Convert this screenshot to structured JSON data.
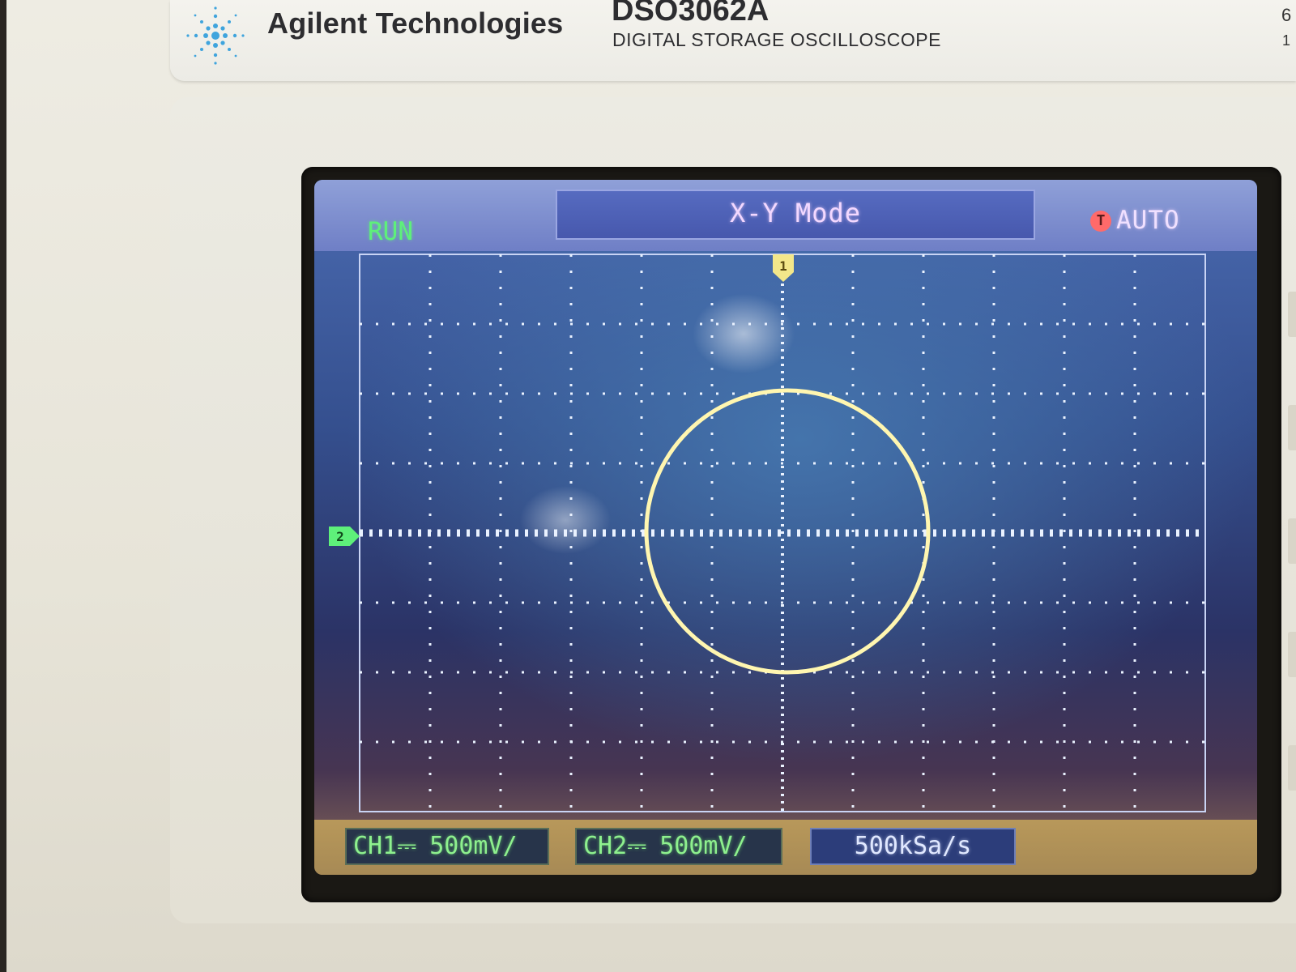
{
  "header": {
    "brand": "Agilent Technologies",
    "model": "DSO3062A",
    "model_subtitle": "DIGITAL STORAGE OSCILLOSCOPE",
    "edge_digit_top": "6",
    "edge_digit_bottom": "1"
  },
  "screen": {
    "run_status": "RUN",
    "mode_title": "X-Y Mode",
    "trigger_icon": "T",
    "trigger_mode": "AUTO",
    "ch1_scale": "500mV/",
    "ch2_scale": "500mV/",
    "ch1_label": "CH1",
    "ch2_label": "CH2",
    "sample_rate": "500kSa/s",
    "marker_1": "1",
    "marker_2": "2"
  },
  "colors": {
    "run_green": "#5ef07a",
    "trace_yellow": "#fff6b0",
    "grid_white": "#eaf2ff",
    "trigger_red": "#ff6a6a"
  },
  "icons": [
    "agilent-spark-logo-icon",
    "trigger-t-icon",
    "channel-marker-1-icon",
    "channel-marker-2-icon"
  ]
}
